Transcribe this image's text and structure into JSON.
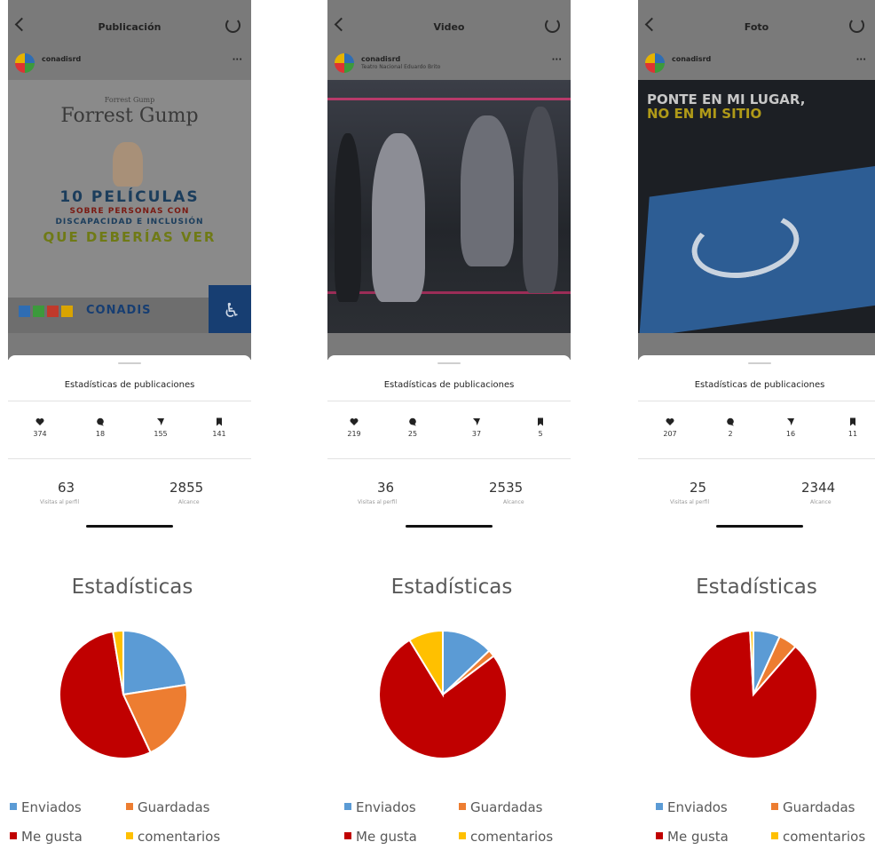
{
  "panels": [
    {
      "header": {
        "title": "Publicación"
      },
      "account": {
        "username": "conadisrd",
        "location": ""
      },
      "media": {
        "type": "image",
        "lines": [
          "Forrest Gump",
          "10 PELÍCULAS",
          "SOBRE PERSONAS CON",
          "DISCAPACIDAD E INCLUSIÓN",
          "QUE DEBERÍAS VER",
          "CONADIS"
        ]
      },
      "sheet": {
        "title": "Estadísticas de publicaciones",
        "likes": "374",
        "comments": "18",
        "shares": "155",
        "saves": "141",
        "profile_visits": "63",
        "profile_visits_label": "Visitas al perfil",
        "reach": "2855",
        "reach_label": "Alcance"
      },
      "chart_data": {
        "type": "pie",
        "title": "Estadísticas",
        "series": [
          {
            "name": "Enviados",
            "value": 155
          },
          {
            "name": "Guardadas",
            "value": 141
          },
          {
            "name": "Me gusta",
            "value": 374
          },
          {
            "name": "comentarios",
            "value": 18
          }
        ],
        "colors": [
          "#5b9bd5",
          "#ed7d31",
          "#c00000",
          "#ffc000"
        ],
        "legend": "bottom"
      }
    },
    {
      "header": {
        "title": "Video"
      },
      "account": {
        "username": "conadisrd",
        "location": "Teatro Nacional Eduardo Brito"
      },
      "media": {
        "type": "video",
        "lines": []
      },
      "sheet": {
        "title": "Estadísticas de publicaciones",
        "likes": "219",
        "comments": "25",
        "shares": "37",
        "saves": "5",
        "profile_visits": "36",
        "profile_visits_label": "Visitas al perfil",
        "reach": "2535",
        "reach_label": "Alcance"
      },
      "chart_data": {
        "type": "pie",
        "title": "Estadísticas",
        "series": [
          {
            "name": "Enviados",
            "value": 37
          },
          {
            "name": "Guardadas",
            "value": 5
          },
          {
            "name": "Me gusta",
            "value": 219
          },
          {
            "name": "comentarios",
            "value": 25
          }
        ],
        "colors": [
          "#5b9bd5",
          "#ed7d31",
          "#c00000",
          "#ffc000"
        ],
        "legend": "bottom"
      }
    },
    {
      "header": {
        "title": "Foto"
      },
      "account": {
        "username": "conadisrd",
        "location": ""
      },
      "media": {
        "type": "image",
        "lines": [
          "PONTE EN MI LUGAR,",
          "NO EN MI SITIO"
        ]
      },
      "sheet": {
        "title": "Estadísticas de publicaciones",
        "likes": "207",
        "comments": "2",
        "shares": "16",
        "saves": "11",
        "profile_visits": "25",
        "profile_visits_label": "Visitas al perfil",
        "reach": "2344",
        "reach_label": "Alcance"
      },
      "chart_data": {
        "type": "pie",
        "title": "Estadísticas",
        "series": [
          {
            "name": "Enviados",
            "value": 16
          },
          {
            "name": "Guardadas",
            "value": 11
          },
          {
            "name": "Me gusta",
            "value": 207
          },
          {
            "name": "comentarios",
            "value": 2
          }
        ],
        "colors": [
          "#5b9bd5",
          "#ed7d31",
          "#c00000",
          "#ffc000"
        ],
        "legend": "bottom"
      }
    }
  ]
}
